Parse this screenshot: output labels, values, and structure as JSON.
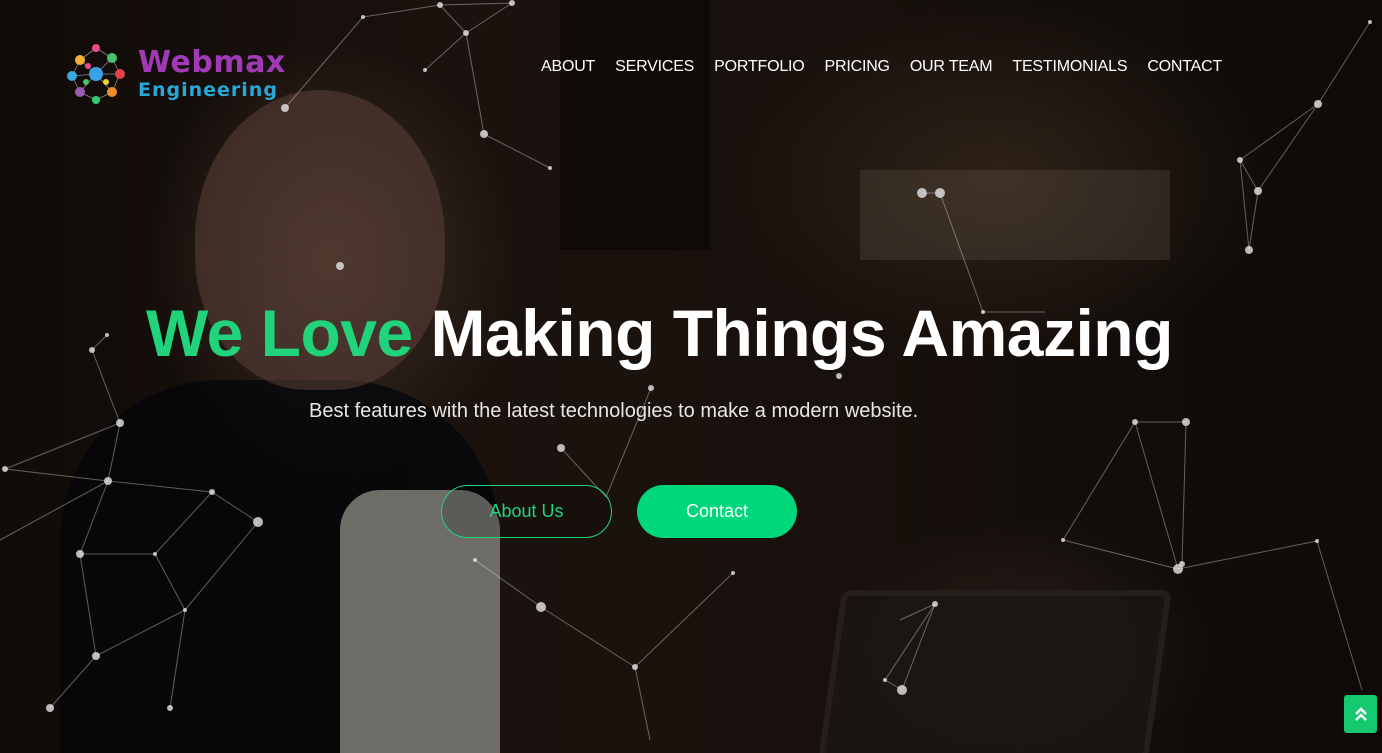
{
  "brand": {
    "name": "Webmax",
    "tagline": "Engineering"
  },
  "nav": {
    "items": [
      {
        "label": "ABOUT"
      },
      {
        "label": "SERVICES"
      },
      {
        "label": "PORTFOLIO"
      },
      {
        "label": "PRICING"
      },
      {
        "label": "OUR TEAM"
      },
      {
        "label": "TESTIMONIALS"
      },
      {
        "label": "CONTACT"
      }
    ]
  },
  "hero": {
    "headline_accent": "We Love",
    "headline_rest": "Making Things Amazing",
    "subheadline": "Best features with the latest technologies to make a modern website.",
    "primary_button": "About Us",
    "secondary_button": "Contact"
  },
  "back_to_top": {
    "icon": "double-chevron-up-icon",
    "glyph": "⌃"
  },
  "colors": {
    "accent_green": "#21d37a",
    "button_green": "#00d67a",
    "logo_purple": "#a23ab8",
    "logo_blue": "#2aa7d6"
  }
}
